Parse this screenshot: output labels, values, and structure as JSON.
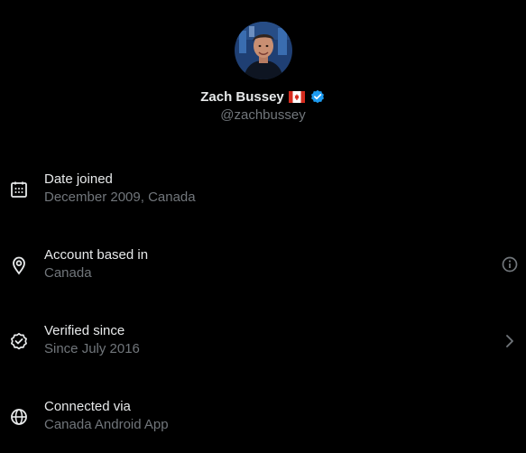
{
  "profile": {
    "display_name": "Zach Bussey",
    "handle": "@zachbussey",
    "avatar_icon": "profile-photo",
    "flag_icon": "canada-flag-icon",
    "verified_icon": "verified-badge-icon"
  },
  "details": [
    {
      "icon": "calendar-icon",
      "label": "Date joined",
      "value": "December 2009, Canada"
    },
    {
      "icon": "location-pin-icon",
      "label": "Account based in",
      "value": "Canada",
      "action_icon": "info-icon"
    },
    {
      "icon": "verified-check-icon",
      "label": "Verified since",
      "value": "Since July 2016",
      "action_icon": "chevron-right-icon"
    },
    {
      "icon": "globe-icon",
      "label": "Connected via",
      "value": "Canada Android App"
    }
  ],
  "colors": {
    "background": "#000000",
    "primary_text": "#e7e9ea",
    "secondary_text": "#71767b",
    "verified_blue": "#1d9bf0",
    "flag_red": "#d52b1e"
  }
}
